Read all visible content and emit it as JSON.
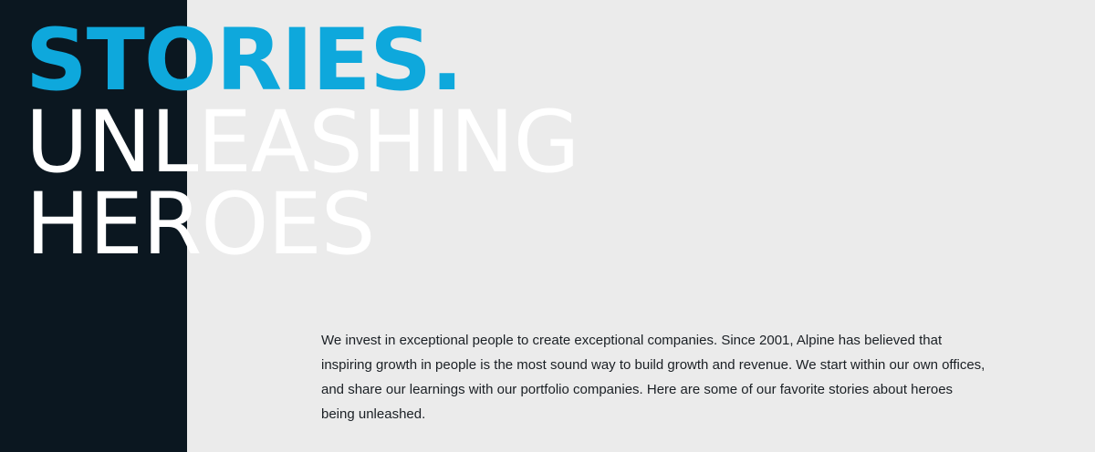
{
  "hero": {
    "line1": "STORIES.",
    "line2": "UNLEASHING",
    "line3": "HEROES"
  },
  "intro": {
    "text": "We invest in exceptional people to create exceptional companies. Since 2001, Alpine has believed that inspiring growth in people is the most sound way to build growth and revenue. We start within our own offices, and share our learnings with our portfolio companies. Here are some of our favorite stories about heroes being unleashed."
  },
  "colors": {
    "accent": "#0ea8dc",
    "panel": "#0b1720",
    "background": "#ebebeb",
    "text": "#1a1f24"
  }
}
